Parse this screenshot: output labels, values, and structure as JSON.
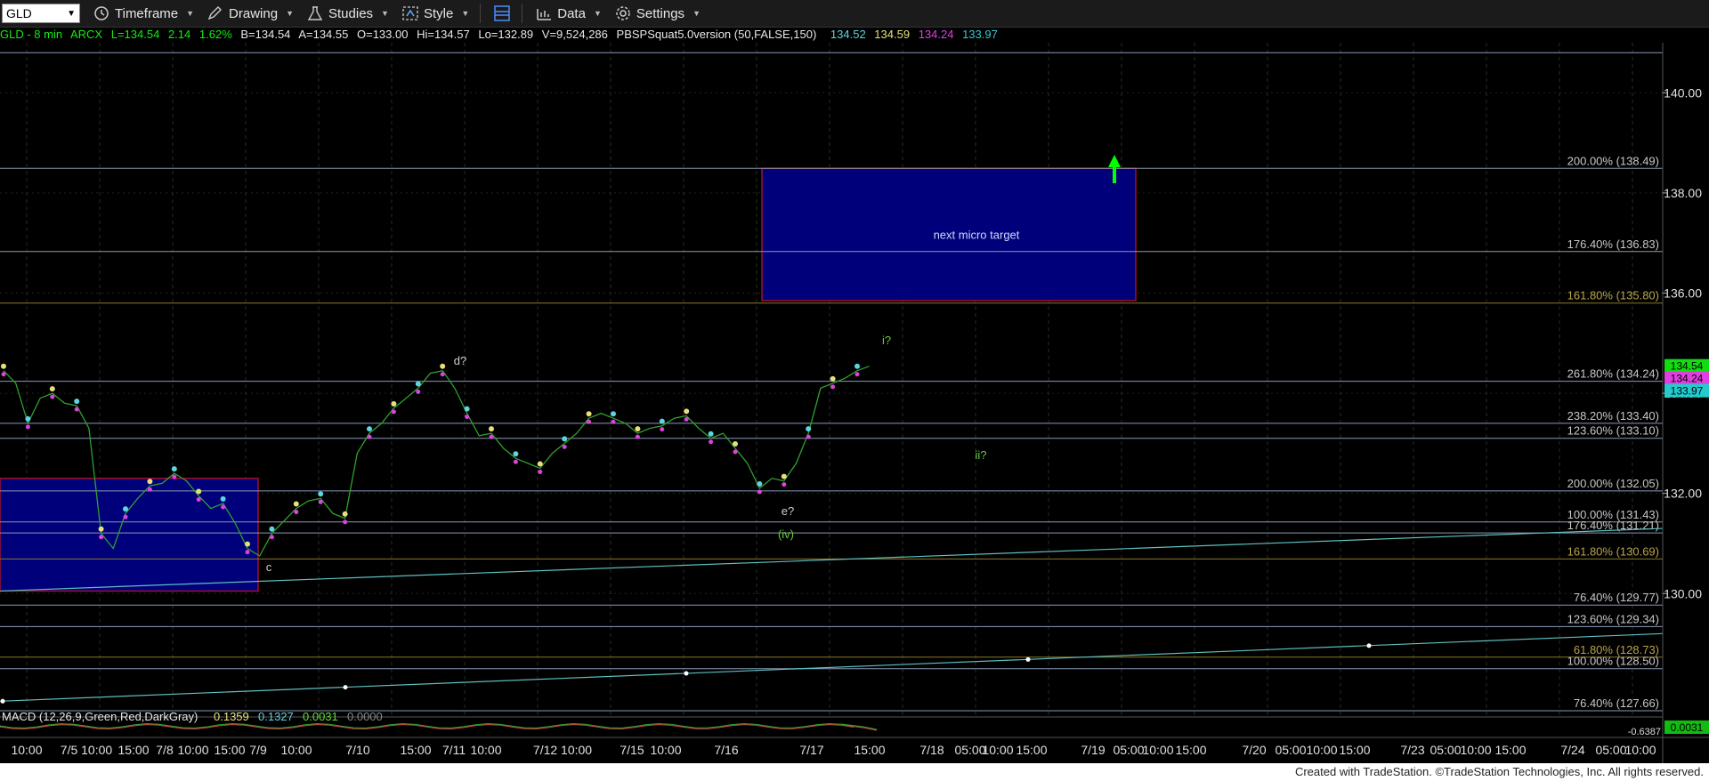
{
  "toolbar": {
    "symbol": "GLD",
    "items": [
      {
        "label": "Timeframe",
        "icon": "clock-icon"
      },
      {
        "label": "Drawing",
        "icon": "pencil-icon"
      },
      {
        "label": "Studies",
        "icon": "flask-icon"
      },
      {
        "label": "Style",
        "icon": "style-icon"
      },
      {
        "label": "Data",
        "icon": "data-icon"
      },
      {
        "label": "Settings",
        "icon": "gear-icon"
      }
    ]
  },
  "info": {
    "title": "GLD - 8 min",
    "exchange": "ARCX",
    "last": "L=134.54",
    "change": "2.14",
    "pct": "1.62%",
    "bid": "B=134.54",
    "ask": "A=134.55",
    "open": "O=133.00",
    "hi": "Hi=134.57",
    "lo": "Lo=132.89",
    "vol": "V=9,524,286",
    "study": "PBSPSquat5.0version (50,FALSE,150)",
    "study_values": [
      {
        "v": "134.52",
        "color": "#5fd3e0"
      },
      {
        "v": "134.59",
        "color": "#e6e07a"
      },
      {
        "v": "134.24",
        "color": "#e040e0"
      },
      {
        "v": "133.97",
        "color": "#33cccc"
      }
    ]
  },
  "colors": {
    "up": "#00ff00",
    "text": "#d8d8d8",
    "fibline": "#8a98b8",
    "gold": "#8a7a2a",
    "cyan": "#5fbfbf",
    "box": "#00007a",
    "box_border": "#a0102a"
  },
  "chart_data": {
    "type": "line",
    "title": "GLD - 8 min",
    "ylim": [
      127.5,
      141
    ],
    "y_ticks": [
      130,
      132,
      134,
      136,
      138,
      140
    ],
    "x_tick_labels": [
      "10:00",
      "7/5 10:00",
      "15:00",
      "7/8",
      "10:00",
      "15:00",
      "7/9",
      "10:00",
      "7/10",
      "15:00",
      "7/11",
      "10:00",
      "7/12 10:00",
      "7/15",
      "10:00",
      "7/16",
      "7/17",
      "15:00",
      "7/18",
      "05:00",
      "10:00",
      "15:00",
      "7/19",
      "05:00",
      "10:00",
      "15:00",
      "7/20",
      "05:00",
      "10:00",
      "15:00",
      "7/23",
      "05:00",
      "10:00",
      "15:00",
      "7/24",
      "05:00",
      "10:00"
    ],
    "price_series": [
      [
        0,
        134.45
      ],
      [
        1,
        134.2
      ],
      [
        2,
        133.4
      ],
      [
        3,
        133.9
      ],
      [
        4,
        134.0
      ],
      [
        5,
        133.8
      ],
      [
        6,
        133.75
      ],
      [
        7,
        133.3
      ],
      [
        8,
        131.2
      ],
      [
        9,
        130.9
      ],
      [
        10,
        131.6
      ],
      [
        11,
        131.9
      ],
      [
        12,
        132.15
      ],
      [
        13,
        132.2
      ],
      [
        14,
        132.4
      ],
      [
        15,
        132.25
      ],
      [
        16,
        131.95
      ],
      [
        17,
        131.7
      ],
      [
        18,
        131.8
      ],
      [
        19,
        131.4
      ],
      [
        20,
        130.9
      ],
      [
        21,
        130.75
      ],
      [
        22,
        131.2
      ],
      [
        23,
        131.45
      ],
      [
        24,
        131.7
      ],
      [
        25,
        131.85
      ],
      [
        26,
        131.9
      ],
      [
        27,
        131.6
      ],
      [
        28,
        131.5
      ],
      [
        29,
        132.8
      ],
      [
        30,
        133.2
      ],
      [
        31,
        133.4
      ],
      [
        32,
        133.7
      ],
      [
        33,
        133.9
      ],
      [
        34,
        134.1
      ],
      [
        35,
        134.4
      ],
      [
        36,
        134.45
      ],
      [
        37,
        134.1
      ],
      [
        38,
        133.6
      ],
      [
        39,
        133.15
      ],
      [
        40,
        133.2
      ],
      [
        41,
        132.9
      ],
      [
        42,
        132.7
      ],
      [
        43,
        132.6
      ],
      [
        44,
        132.5
      ],
      [
        45,
        132.8
      ],
      [
        46,
        133.0
      ],
      [
        47,
        133.2
      ],
      [
        48,
        133.5
      ],
      [
        49,
        133.6
      ],
      [
        50,
        133.5
      ],
      [
        51,
        133.4
      ],
      [
        52,
        133.2
      ],
      [
        53,
        133.3
      ],
      [
        54,
        133.35
      ],
      [
        55,
        133.5
      ],
      [
        56,
        133.55
      ],
      [
        57,
        133.3
      ],
      [
        58,
        133.1
      ],
      [
        59,
        133.2
      ],
      [
        60,
        132.9
      ],
      [
        61,
        132.6
      ],
      [
        62,
        132.1
      ],
      [
        63,
        132.3
      ],
      [
        64,
        132.25
      ],
      [
        65,
        132.6
      ],
      [
        66,
        133.2
      ],
      [
        67,
        134.1
      ],
      [
        68,
        134.2
      ],
      [
        69,
        134.3
      ],
      [
        70,
        134.45
      ],
      [
        71,
        134.54
      ]
    ],
    "fib_levels": [
      {
        "label": "200.00% (138.49)",
        "value": 138.49,
        "color": "#8a98b8"
      },
      {
        "label": "176.40% (136.83)",
        "value": 136.83,
        "color": "#8a98b8"
      },
      {
        "label": "161.80% (135.80)",
        "value": 135.8,
        "color": "#8a7a2a"
      },
      {
        "label": "261.80% (134.24)",
        "value": 134.24,
        "color": "#8a98b8"
      },
      {
        "label": "238.20% (133.40)",
        "value": 133.4,
        "color": "#8a98b8"
      },
      {
        "label": "123.60% (133.10)",
        "value": 133.1,
        "color": "#8a98b8"
      },
      {
        "label": "200.00% (132.05)",
        "value": 132.05,
        "color": "#8a98b8"
      },
      {
        "label": "100.00% (131.43)",
        "value": 131.43,
        "color": "#8a98b8"
      },
      {
        "label": "176.40% (131.21)",
        "value": 131.21,
        "color": "#8a98b8"
      },
      {
        "label": "161.80% (130.69)",
        "value": 130.69,
        "color": "#8a7a2a"
      },
      {
        "label": "76.40% (129.77)",
        "value": 129.77,
        "color": "#8a98b8"
      },
      {
        "label": "123.60% (129.34)",
        "value": 129.34,
        "color": "#8a98b8"
      },
      {
        "label": "61.80% (128.73)",
        "value": 128.73,
        "color": "#8a7a2a"
      },
      {
        "label": "100.00% (128.50)",
        "value": 128.5,
        "color": "#8a98b8"
      },
      {
        "label": "76.40% (127.66)",
        "value": 127.66,
        "color": "#8a98b8"
      }
    ],
    "target_box": {
      "label": "next micro target",
      "y_top": 138.49,
      "y_bottom": 135.85
    },
    "lower_box": {
      "y_top": 132.3,
      "y_bottom": 130.05
    },
    "wave_labels": [
      {
        "text": "d?",
        "color": "#cfcfcf"
      },
      {
        "text": "e?",
        "color": "#cfcfcf"
      },
      {
        "text": "(iv)",
        "color": "#66cc33"
      },
      {
        "text": "c",
        "color": "#cfcfcf"
      },
      {
        "text": "i?",
        "color": "#66cc33"
      },
      {
        "text": "ii?",
        "color": "#66cc33"
      }
    ],
    "price_tags": [
      {
        "v": "134.54",
        "color": "#11dd11",
        "text_color": "#000"
      },
      {
        "v": "134.24",
        "color": "#e040e0",
        "text_color": "#000"
      },
      {
        "v": "133.97",
        "color": "#22cccc",
        "text_color": "#000"
      }
    ],
    "macd": {
      "label": "MACD (12,26,9,Green,Red,DarkGray)",
      "values": [
        "0.1359",
        "0.1327",
        "0.0031",
        "0.0000"
      ],
      "colors": [
        "#e6e07a",
        "#5fd3e0",
        "#66dd33",
        "#888888"
      ],
      "tag": "0.0031",
      "tag2": "-0.6387"
    }
  },
  "footer": {
    "text": "Created with TradeStation. ©TradeStation Technologies, Inc. All rights reserved."
  }
}
